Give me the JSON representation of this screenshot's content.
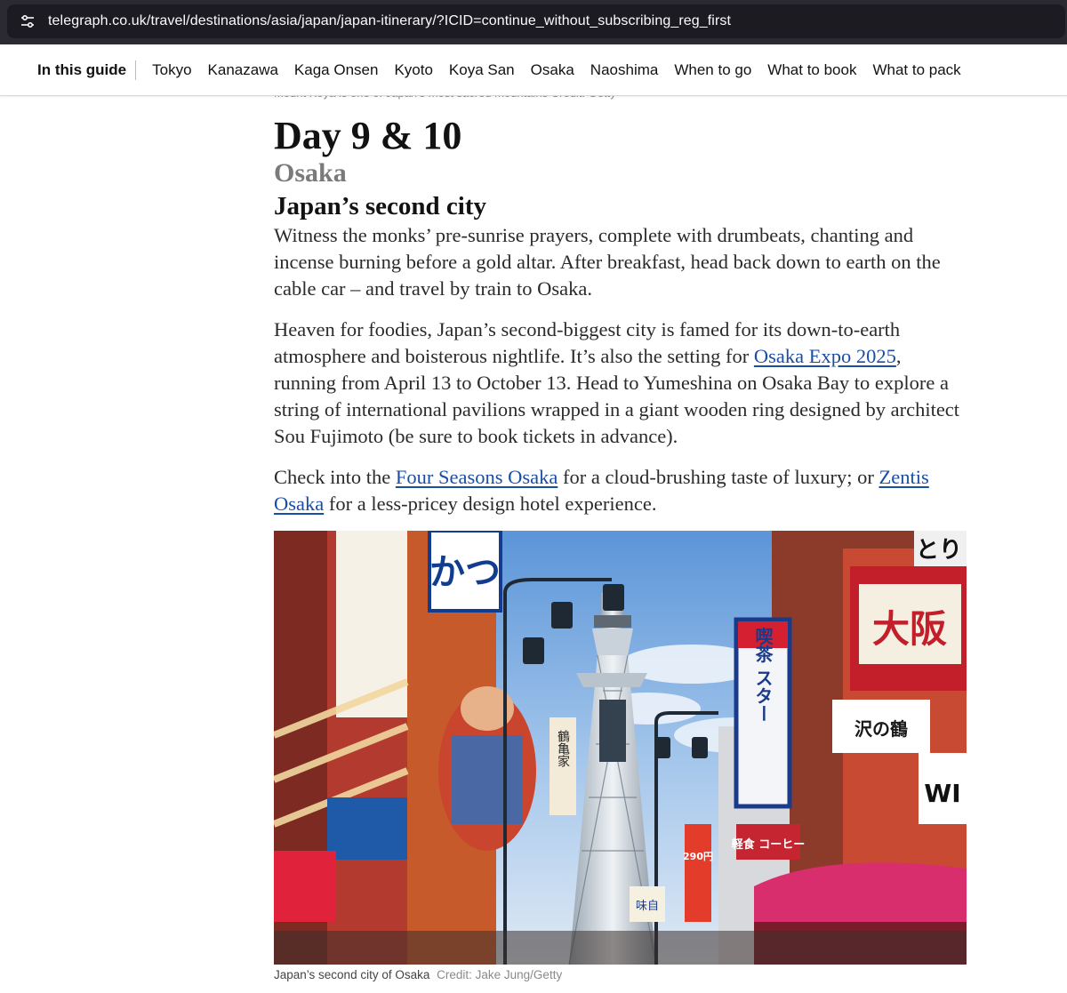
{
  "browser": {
    "url": "telegraph.co.uk/travel/destinations/asia/japan/japan-itinerary/?ICID=continue_without_subscribing_reg_first",
    "site_icon": "tune-icon"
  },
  "guide_nav": {
    "label": "In this guide",
    "links": [
      "Tokyo",
      "Kanazawa",
      "Kaga Onsen",
      "Kyoto",
      "Koya San",
      "Osaka",
      "Naoshima",
      "When to go",
      "What to book",
      "What to pack"
    ]
  },
  "previous_caption": "Mount Koya is one of Japan's most sacred mountains  Credit: Getty",
  "article": {
    "day": "Day 9 & 10",
    "place": "Osaka",
    "subhead": "Japan’s second city",
    "p1": "Witness the monks’ pre-sunrise prayers, complete with drumbeats, chanting and incense burning before a gold altar. After breakfast, head back down to earth on the cable car – and travel by train to Osaka.",
    "p2_a": "Heaven for foodies, Japan’s second-biggest city is famed for its down-to-earth atmosphere and boisterous nightlife. It’s also the setting for ",
    "p2_link": "Osaka Expo 2025",
    "p2_b": ", running from April 13 to October 13. Head to Yumeshina on Osaka Bay to explore a string of international pavilions wrapped in a giant wooden ring designed by architect Sou Fujimoto (be sure to book tickets in advance).",
    "p3_a": "Check into the ",
    "p3_link1": "Four Seasons Osaka",
    "p3_b": " for a cloud-brushing taste of luxury; or ",
    "p3_link2": "Zentis Osaka",
    "p3_c": " for a less-pricey design hotel experience."
  },
  "photo": {
    "caption": "Japan’s second city of Osaka",
    "credit": "Credit: Jake Jung/Getty",
    "signs": {
      "star_vertical": "喫茶 スター",
      "big_sign": "大阪",
      "brand": "沢の鶴",
      "kei": "軽食 コーヒー",
      "price": "290円",
      "misoshiru": "味自",
      "kitchen": "鶴亀家",
      "katsu": "かつ",
      "wi": "WI",
      "tori": "とり"
    }
  }
}
